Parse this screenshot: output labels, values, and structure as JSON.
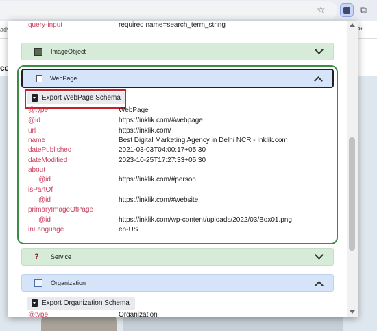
{
  "browser": {
    "bookmark_left": "advi",
    "bookmark_overflow": "»",
    "page_fragment": "co",
    "star_icon": "star-icon",
    "extension_icon": "schema-extension-icon",
    "puzzle_icon": "extensions-puzzle-icon"
  },
  "top_row": {
    "key": "query-input",
    "value": "required name=search_term_string"
  },
  "sections": {
    "imageobject": {
      "title": "ImageObject",
      "icon": "image-icon"
    },
    "webpage": {
      "title": "WebPage",
      "icon": "document-icon",
      "export_label": "Export WebPage Schema",
      "rows": [
        {
          "key": "@type",
          "value": "WebPage"
        },
        {
          "key": "@id",
          "value": "https://inklik.com/#webpage"
        },
        {
          "key": "url",
          "value": "https://inklik.com/"
        },
        {
          "key": "name",
          "value": "Best Digital Marketing Agency in Delhi NCR - Inklik.com"
        },
        {
          "key": "datePublished",
          "value": "2021-03-03T04:00:17+05:30"
        },
        {
          "key": "dateModified",
          "value": "2023-10-25T17:27:33+05:30"
        },
        {
          "key": "about",
          "value": ""
        },
        {
          "key": "@id",
          "value": "https://inklik.com/#person"
        },
        {
          "key": "isPartOf",
          "value": ""
        },
        {
          "key": "@id",
          "value": "https://inklik.com/#website"
        },
        {
          "key": "primaryImageOfPage",
          "value": ""
        },
        {
          "key": "@id",
          "value": "https://inklik.com/wp-content/uploads/2022/03/Box01.png"
        },
        {
          "key": "inLanguage",
          "value": "en-US"
        }
      ]
    },
    "service": {
      "title": "Service",
      "icon": "question-mark-icon"
    },
    "organization": {
      "title": "Organization",
      "icon": "organization-icon",
      "export_label": "Export Organization Schema",
      "rows": [
        {
          "key": "@type",
          "value": "Organization"
        }
      ]
    }
  },
  "colors": {
    "key_color": "#c94361",
    "green_section": "#d6ecd8",
    "blue_section": "#d5e4f8",
    "highlight_frame": "#3b8c47",
    "highlight_button": "#c8202b"
  }
}
